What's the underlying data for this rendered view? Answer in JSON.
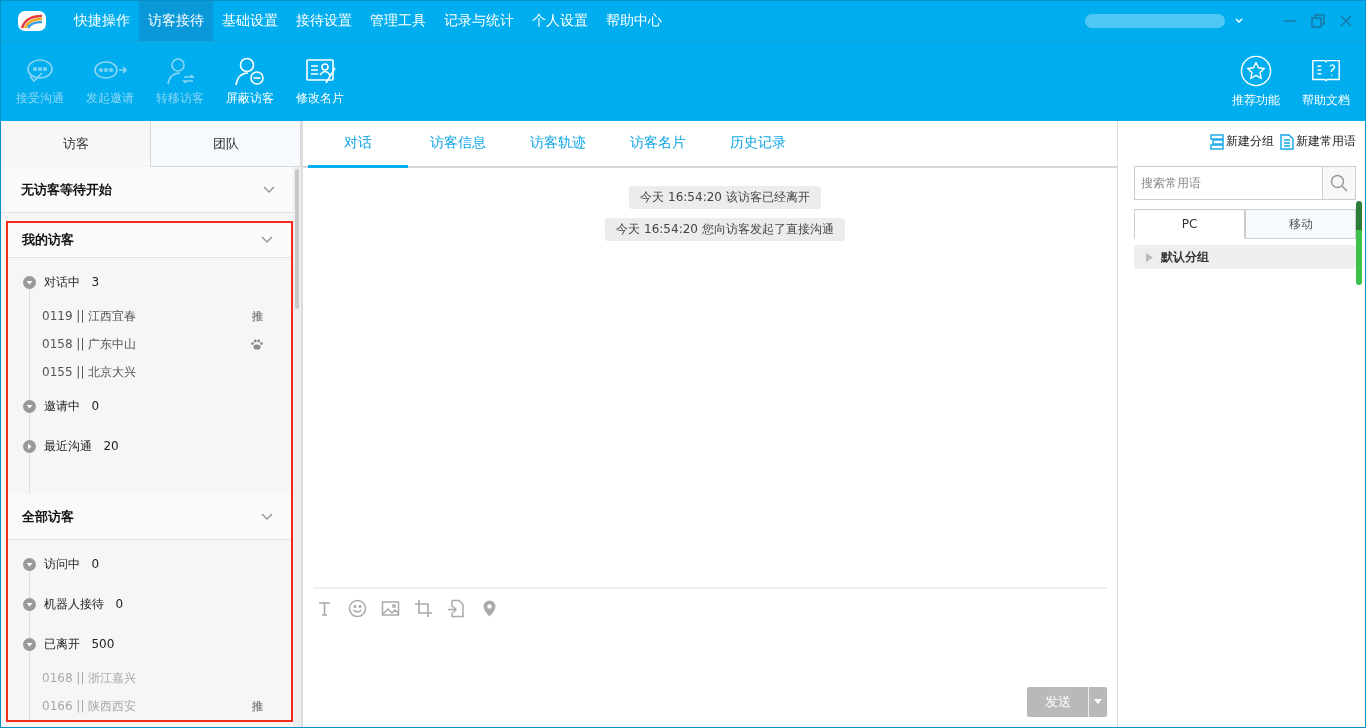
{
  "menu": [
    {
      "label": "快捷操作",
      "selected": false
    },
    {
      "label": "访客接待",
      "selected": true
    },
    {
      "label": "基础设置",
      "selected": false
    },
    {
      "label": "接待设置",
      "selected": false
    },
    {
      "label": "管理工具",
      "selected": false
    },
    {
      "label": "记录与统计",
      "selected": false
    },
    {
      "label": "个人设置",
      "selected": false
    },
    {
      "label": "帮助中心",
      "selected": false
    }
  ],
  "toolbar": [
    {
      "label": "接受沟通",
      "kind": "accept",
      "disabled": true
    },
    {
      "label": "发起邀请",
      "kind": "invite",
      "disabled": true
    },
    {
      "label": "转移访客",
      "kind": "transfer",
      "disabled": true
    },
    {
      "label": "屏蔽访客",
      "kind": "block",
      "disabled": false
    },
    {
      "label": "修改名片",
      "kind": "card",
      "disabled": false
    }
  ],
  "right_tools": [
    {
      "label": "推荐功能",
      "kind": "star"
    },
    {
      "label": "帮助文档",
      "kind": "book"
    }
  ],
  "left_tabs": [
    {
      "label": "访客",
      "selected": true
    },
    {
      "label": "团队",
      "selected": false
    }
  ],
  "sections": [
    {
      "title": "无访客等待开始",
      "highlighted": false
    },
    {
      "title": "我的访客",
      "highlighted": true,
      "groups": [
        {
          "label": "对话中",
          "count": "3",
          "expanded": true,
          "visitors": [
            {
              "text": "0119 || 江西宜春",
              "offline": false,
              "kind": "tag",
              "tag": "推"
            },
            {
              "text": "0158 || 广东中山",
              "offline": false,
              "kind": "paw"
            },
            {
              "text": "0155 || 北京大兴",
              "offline": false,
              "kind": "plain"
            }
          ]
        },
        {
          "label": "邀请中",
          "count": "0",
          "expanded": true
        },
        {
          "label": "最近沟通",
          "count": "20",
          "expanded": false
        }
      ]
    },
    {
      "title": "全部访客",
      "highlighted": true,
      "groups": [
        {
          "label": "访问中",
          "count": "0",
          "expanded": true
        },
        {
          "label": "机器人接待",
          "count": "0",
          "expanded": true
        },
        {
          "label": "已离开",
          "count": "500",
          "expanded": true,
          "visitors": [
            {
              "text": "0168 || 浙江嘉兴",
              "offline": true,
              "kind": "plain"
            },
            {
              "text": "0166 || 陕西西安",
              "offline": true,
              "kind": "tag",
              "tag": "推"
            }
          ]
        }
      ]
    }
  ],
  "chat_tabs": [
    {
      "label": "对话",
      "selected": true
    },
    {
      "label": "访客信息",
      "selected": false
    },
    {
      "label": "访客轨迹",
      "selected": false
    },
    {
      "label": "访客名片",
      "selected": false
    },
    {
      "label": "历史记录",
      "selected": false
    }
  ],
  "messages": [
    "今天 16:54:20 该访客已经离开",
    "今天 16:54:20 您向访客发起了直接沟通"
  ],
  "send_button": {
    "label": "发送",
    "disabled": true
  },
  "phrase_actions": [
    {
      "label": "新建分组",
      "kind": "group"
    },
    {
      "label": "新建常用语",
      "kind": "doc"
    }
  ],
  "phrase_search": {
    "placeholder": "搜索常用语"
  },
  "phrase_tabs": [
    {
      "label": "PC",
      "selected": true
    },
    {
      "label": "移动",
      "selected": false
    }
  ],
  "phrase_groups": [
    {
      "label": "默认分组",
      "expanded": false
    }
  ]
}
